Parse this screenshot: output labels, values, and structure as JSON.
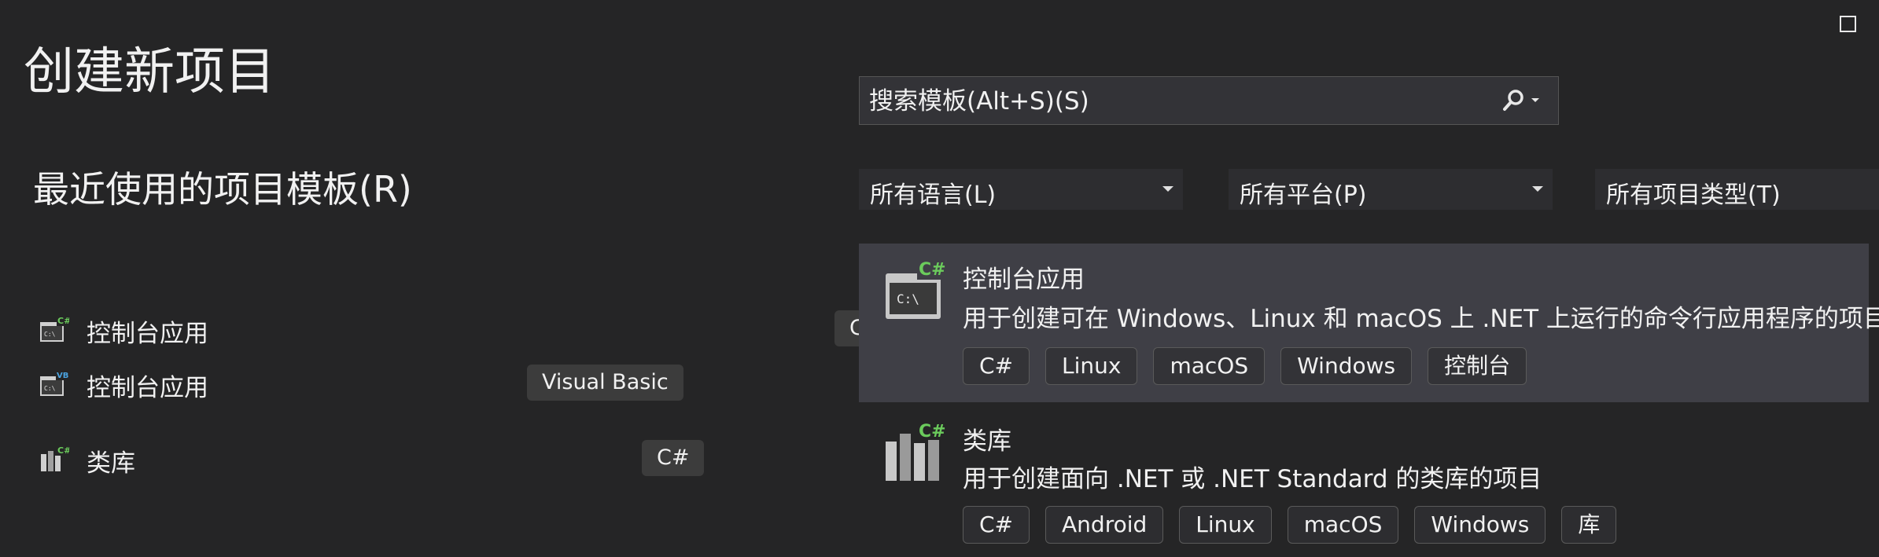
{
  "window": {
    "maximize_icon": "maximize-icon"
  },
  "page_title": "创建新项目",
  "recent": {
    "title": "最近使用的项目模板(R)",
    "items": [
      {
        "label": "控制台应用",
        "tag": "C#",
        "icon": "console-csharp-icon"
      },
      {
        "label": "控制台应用",
        "tag": "Visual Basic",
        "icon": "console-vb-icon"
      },
      {
        "label": "类库",
        "tag": "C#",
        "icon": "class-library-csharp-icon"
      }
    ]
  },
  "search": {
    "placeholder": "搜索模板(Alt+S)(S)",
    "icon": "search-icon"
  },
  "filters": {
    "language": "所有语言(L)",
    "platform": "所有平台(P)",
    "project_type": "所有项目类型(T)"
  },
  "templates": [
    {
      "name": "控制台应用",
      "description": "用于创建可在 Windows、Linux 和 macOS 上 .NET 上运行的命令行应用程序的项目",
      "tags": [
        "C#",
        "Linux",
        "macOS",
        "Windows",
        "控制台"
      ],
      "icon": "console-app-icon",
      "selected": true
    },
    {
      "name": "类库",
      "description": "用于创建面向 .NET 或 .NET Standard 的类库的项目",
      "tags": [
        "C#",
        "Android",
        "Linux",
        "macOS",
        "Windows",
        "库"
      ],
      "icon": "class-library-icon",
      "selected": false
    }
  ],
  "colors": {
    "background": "#252526",
    "selected": "#3f3f46",
    "csharp_badge": "#388a34"
  }
}
